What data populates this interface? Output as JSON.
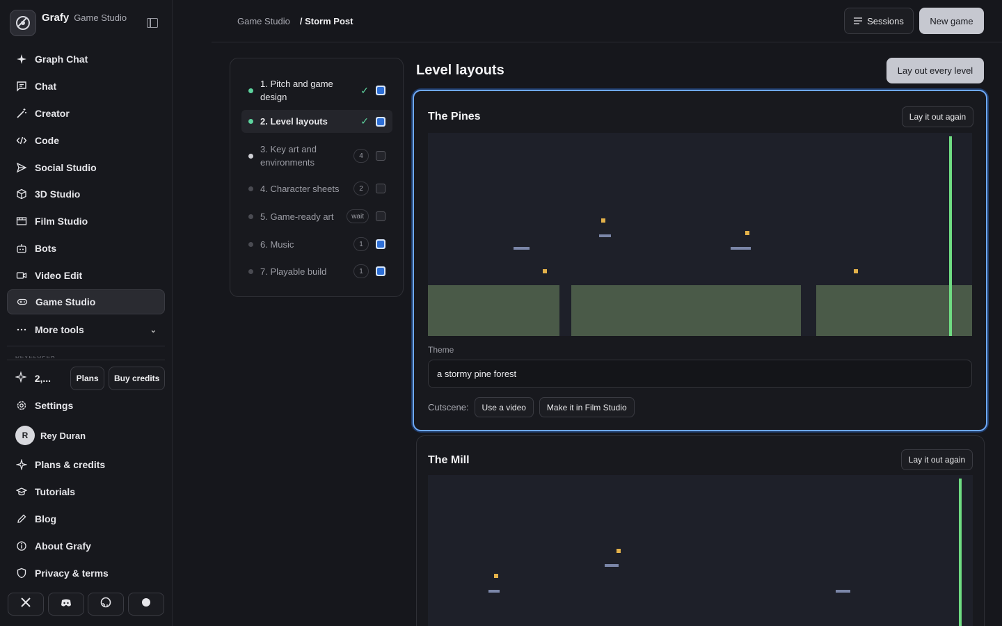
{
  "app": {
    "name": "Grafy",
    "section": "Game Studio"
  },
  "sidebar": {
    "items": [
      {
        "label": "Graph Chat",
        "icon": "sparkle-icon"
      },
      {
        "label": "Chat",
        "icon": "chat-icon"
      },
      {
        "label": "Creator",
        "icon": "wand-icon"
      },
      {
        "label": "Code",
        "icon": "code-icon"
      },
      {
        "label": "Social Studio",
        "icon": "send-icon"
      },
      {
        "label": "3D Studio",
        "icon": "cube-icon"
      },
      {
        "label": "Film Studio",
        "icon": "film-icon"
      },
      {
        "label": "Bots",
        "icon": "bot-icon"
      },
      {
        "label": "Video Edit",
        "icon": "video-icon"
      },
      {
        "label": "Game Studio",
        "icon": "gamepad-icon",
        "active": true
      },
      {
        "label": "More tools",
        "icon": "more-icon"
      }
    ],
    "section_label": "DEVELOPER",
    "credits": {
      "value": "2,...",
      "plans_label": "Plans",
      "buy_label": "Buy credits"
    },
    "settings_label": "Settings",
    "user": {
      "initial": "R",
      "name": "Rey Duran"
    },
    "footer_items": [
      {
        "label": "Plans & credits",
        "icon": "sparkle-icon"
      },
      {
        "label": "Tutorials",
        "icon": "graduation-cap-icon"
      },
      {
        "label": "Blog",
        "icon": "pencil-icon"
      },
      {
        "label": "About Grafy",
        "icon": "info-icon"
      },
      {
        "label": "Privacy & terms",
        "icon": "shield-icon"
      }
    ],
    "social": [
      "x-icon",
      "discord-icon",
      "github-icon",
      "circle-icon"
    ]
  },
  "header": {
    "breadcrumb": [
      "Game Studio",
      "/ Storm Post"
    ],
    "sessions_label": "Sessions",
    "new_game_label": "New game"
  },
  "steps": [
    {
      "label": "1. Pitch and game design",
      "status": "done",
      "checked": true
    },
    {
      "label": "2. Level layouts",
      "status": "done",
      "checked": true,
      "active": true
    },
    {
      "label": "3. Key art and environments",
      "badge": "4",
      "checked": false
    },
    {
      "label": "4. Character sheets",
      "badge": "2",
      "checked": false
    },
    {
      "label": "5. Game-ready art",
      "badge": "wait",
      "checked": false
    },
    {
      "label": "6. Music",
      "badge": "1",
      "checked": true
    },
    {
      "label": "7. Playable build",
      "badge": "1",
      "checked": true
    }
  ],
  "main": {
    "title": "Level layouts",
    "lay_out_all_label": "Lay out every level",
    "levels": [
      {
        "name": "The Pines",
        "again_label": "Lay it out again",
        "theme_label": "Theme",
        "theme_value": "a stormy pine forest",
        "cutscene_label": "Cutscene:",
        "cutscene_buttons": [
          "Use a video",
          "Make it in Film Studio"
        ]
      },
      {
        "name": "The Mill",
        "again_label": "Lay it out again"
      }
    ]
  },
  "colors": {
    "accent": "#6ea8f5",
    "ground": "#4a5a48",
    "coin": "#e3b14a",
    "platform": "#7b86a8",
    "goal": "#6fdc82",
    "done": "#5dd39e"
  }
}
